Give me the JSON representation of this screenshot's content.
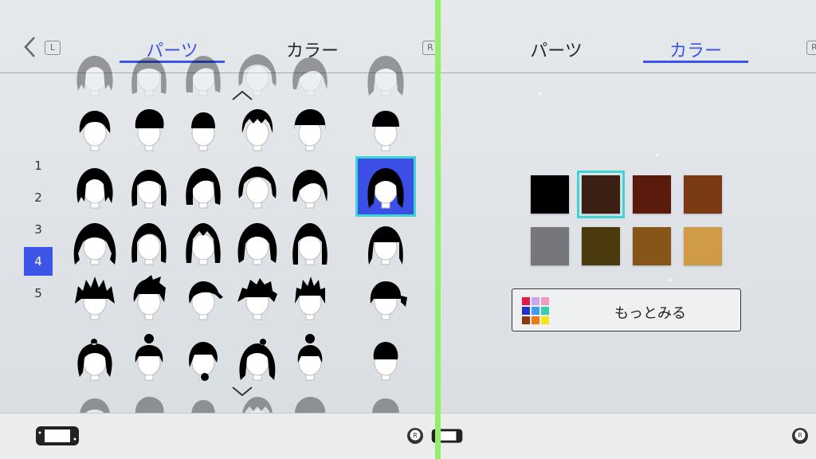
{
  "left": {
    "tabs": [
      {
        "label": "パーツ",
        "active": true
      },
      {
        "label": "カラー",
        "active": false
      }
    ],
    "button_hints": {
      "l": "L",
      "r": "R"
    },
    "page_numbers": [
      "1",
      "2",
      "3",
      "4",
      "5"
    ],
    "selected_page": "4",
    "hair_rows": 5,
    "hair_cols": 6,
    "selected_hair": {
      "row": 2,
      "col": 6
    }
  },
  "right": {
    "tabs": [
      {
        "label": "パーツ",
        "active": false
      },
      {
        "label": "カラー",
        "active": true
      }
    ],
    "swatches": [
      "#000000",
      "#3c1f13",
      "#5a1a0c",
      "#7a3a14",
      "#76767c",
      "#4a3a0e",
      "#875518",
      "#cf9b46"
    ],
    "selected_swatch": 2,
    "more_button_label": "もっとみる",
    "more_palette": [
      "#e8174a",
      "#c9a7ef",
      "#f39ac5",
      "#2233cc",
      "#3a9ef0",
      "#33d0aa",
      "#8a3a10",
      "#f07a10",
      "#f5e51a"
    ]
  },
  "colors": {
    "accent": "#3d55e6",
    "selection_outline": "#3fd3d3",
    "divider": "#93ee6a"
  }
}
